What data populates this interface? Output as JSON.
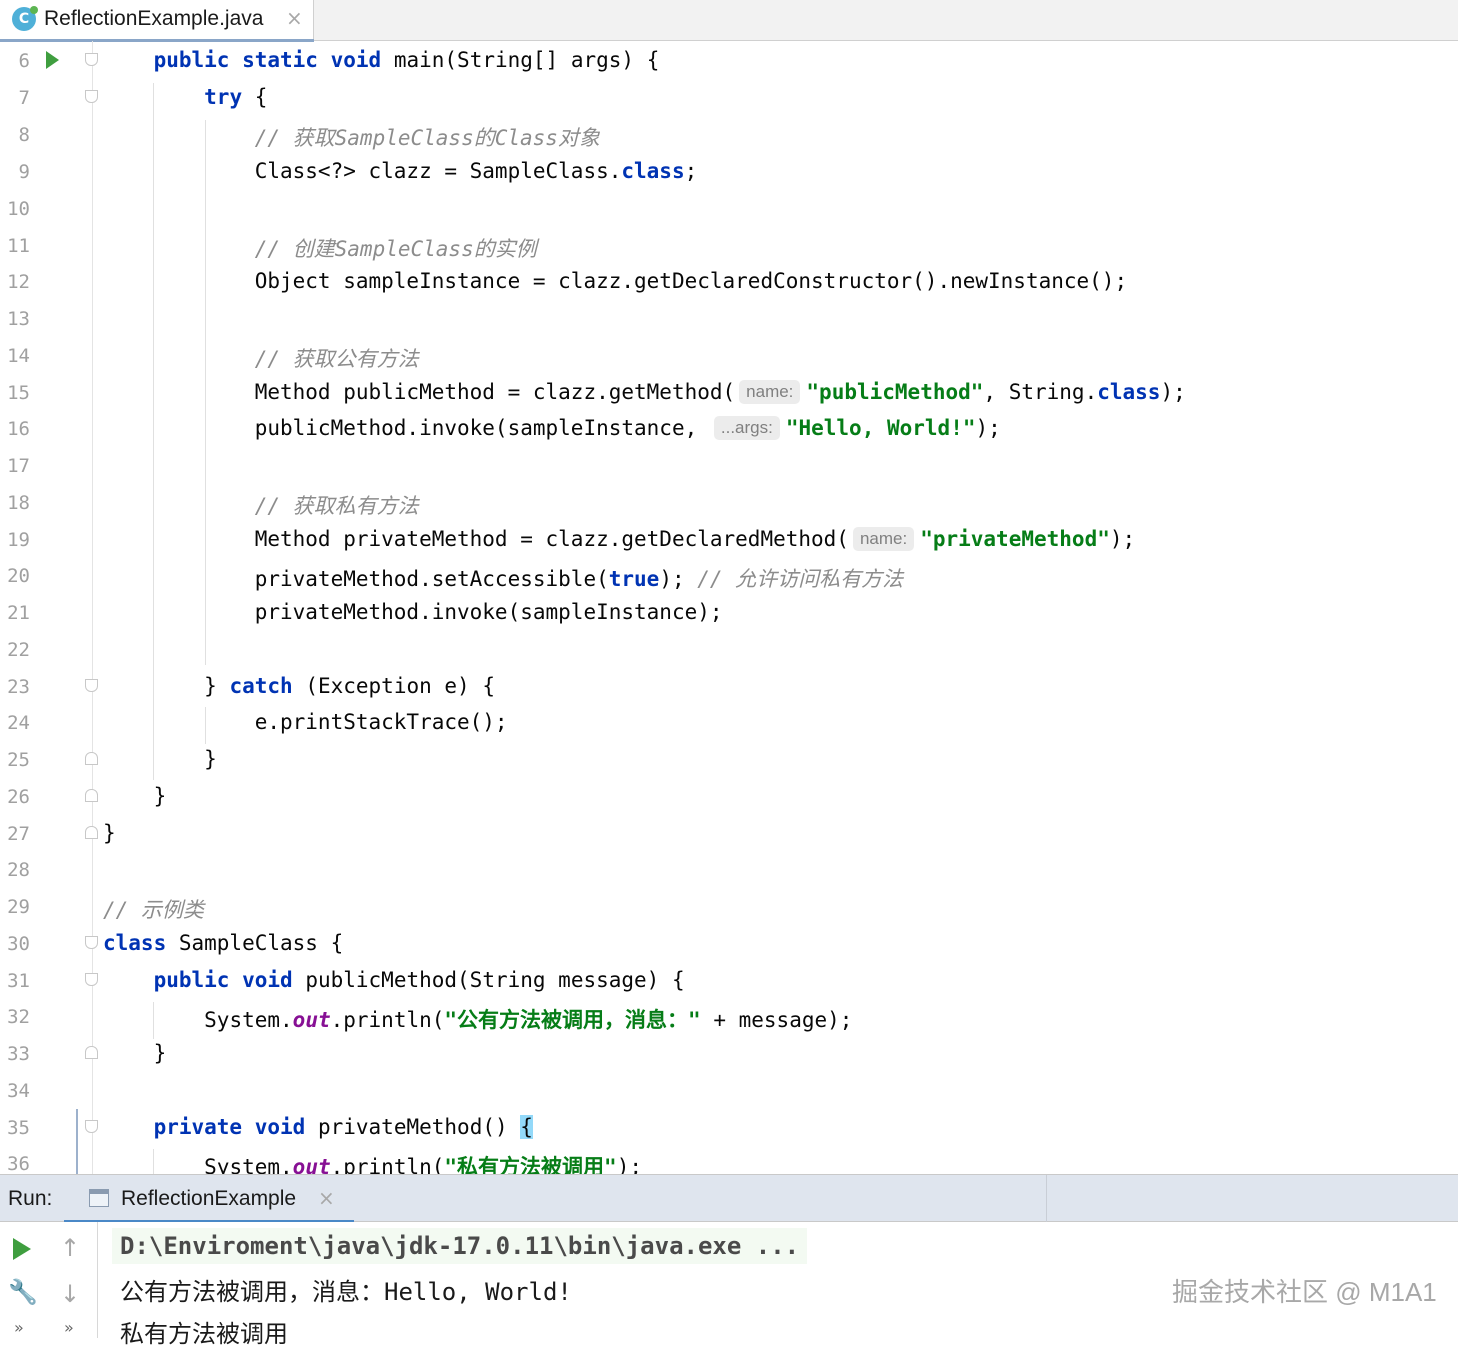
{
  "editor_tab": {
    "title": "ReflectionExample.java",
    "close": "×"
  },
  "code": {
    "l6": {
      "num": "6",
      "a": "    ",
      "kw1": "public",
      "kw2": "static",
      "kw3": "void",
      "b": " main(String[] args) {"
    },
    "l7": {
      "num": "7",
      "kw1": "try",
      "b": " {"
    },
    "l8": {
      "num": "8",
      "c": "// 获取SampleClass的Class对象"
    },
    "l9": {
      "num": "9",
      "a": "Class<?> clazz = SampleClass.",
      "kw1": "class",
      "b": ";"
    },
    "l10": {
      "num": "10"
    },
    "l11": {
      "num": "11",
      "c": "// 创建SampleClass的实例"
    },
    "l12": {
      "num": "12",
      "a": "Object sampleInstance = clazz.getDeclaredConstructor().newInstance();"
    },
    "l13": {
      "num": "13"
    },
    "l14": {
      "num": "14",
      "c": "// 获取公有方法"
    },
    "l15": {
      "num": "15",
      "a": "Method publicMethod = clazz.getMethod(",
      "hint": "name:",
      "s": "\"publicMethod\"",
      "b": ", String.",
      "kw1": "class",
      "d": ");"
    },
    "l16": {
      "num": "16",
      "a": "publicMethod.invoke(sampleInstance, ",
      "hint": "...args:",
      "s": "\"Hello, World!\"",
      "b": ");"
    },
    "l17": {
      "num": "17"
    },
    "l18": {
      "num": "18",
      "c": "// 获取私有方法"
    },
    "l19": {
      "num": "19",
      "a": "Method privateMethod = clazz.getDeclaredMethod(",
      "hint": "name:",
      "s": "\"privateMethod\"",
      "b": ");"
    },
    "l20": {
      "num": "20",
      "a": "privateMethod.setAccessible(",
      "kw1": "true",
      "b": "); ",
      "c": "// 允许访问私有方法"
    },
    "l21": {
      "num": "21",
      "a": "privateMethod.invoke(sampleInstance);"
    },
    "l22": {
      "num": "22"
    },
    "l23": {
      "num": "23",
      "a": "} ",
      "kw1": "catch",
      "b": " (Exception e) {"
    },
    "l24": {
      "num": "24",
      "a": "e.printStackTrace();"
    },
    "l25": {
      "num": "25",
      "a": "}"
    },
    "l26": {
      "num": "26",
      "a": "}"
    },
    "l27": {
      "num": "27",
      "a": "}"
    },
    "l28": {
      "num": "28"
    },
    "l29": {
      "num": "29",
      "c": "// 示例类"
    },
    "l30": {
      "num": "30",
      "kw1": "class",
      "b": " SampleClass {"
    },
    "l31": {
      "num": "31",
      "kw1": "public",
      "kw2": "void",
      "b": " publicMethod(String message) {"
    },
    "l32": {
      "num": "32",
      "a": "System.",
      "f": "out",
      "b": ".println(",
      "s": "\"公有方法被调用，消息：\"",
      "d": " + message);"
    },
    "l33": {
      "num": "33",
      "a": "}"
    },
    "l34": {
      "num": "34"
    },
    "l35": {
      "num": "35",
      "kw1": "private",
      "kw2": "void",
      "b": " privateMethod() ",
      "br": "{"
    },
    "l36": {
      "num": "36",
      "a": "System.",
      "f": "out",
      "b": ".println(",
      "s": "\"私有方法被调用\"",
      "d": ");"
    }
  },
  "run_window": {
    "label": "Run:",
    "tab_title": "ReflectionExample",
    "tab_close": "×",
    "up_icon": "↑",
    "down_icon": "↓",
    "more": "»",
    "output": {
      "cmd": "D:\\Enviroment\\java\\jdk-17.0.11\\bin\\java.exe ...",
      "line1": "公有方法被调用，消息：Hello, World!",
      "line2": "私有方法被调用"
    },
    "watermark": "掘金技术社区 @ M1A1"
  }
}
